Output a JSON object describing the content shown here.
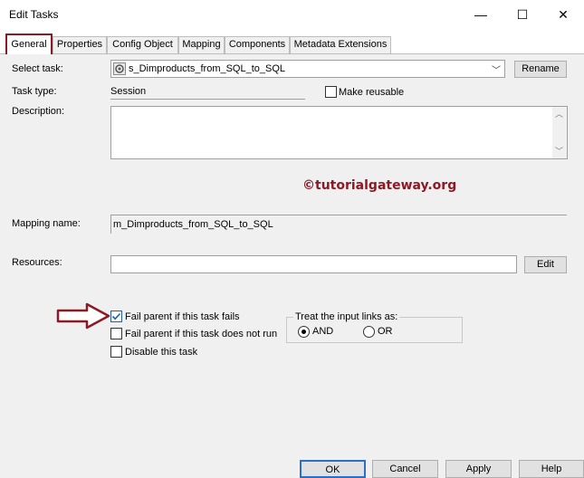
{
  "window": {
    "title": "Edit Tasks",
    "minimize_glyph": "—",
    "maximize_glyph": "☐",
    "close_glyph": "✕"
  },
  "tabs": [
    {
      "label": "General",
      "active": true
    },
    {
      "label": "Properties",
      "active": false
    },
    {
      "label": "Config Object",
      "active": false
    },
    {
      "label": "Mapping",
      "active": false
    },
    {
      "label": "Components",
      "active": false
    },
    {
      "label": "Metadata Extensions",
      "active": false
    }
  ],
  "form": {
    "select_task_label": "Select task:",
    "select_task_value": "s_Dimproducts_from_SQL_to_SQL",
    "rename_label": "Rename",
    "task_type_label": "Task type:",
    "task_type_value": "Session",
    "make_reusable_label": "Make reusable",
    "description_label": "Description:",
    "mapping_name_label": "Mapping name:",
    "mapping_name_value": "m_Dimproducts_from_SQL_to_SQL",
    "resources_label": "Resources:",
    "edit_label": "Edit"
  },
  "watermark": "©tutorialgateway.org",
  "options": {
    "fail_parent_fails_label": "Fail parent if this task fails",
    "fail_parent_fails_checked": true,
    "fail_parent_not_run_label": "Fail parent if this task does not run",
    "fail_parent_not_run_checked": false,
    "disable_task_label": "Disable this task",
    "disable_task_checked": false
  },
  "input_links": {
    "legend": "Treat the input links as:",
    "and_label": "AND",
    "or_label": "OR",
    "selected": "AND"
  },
  "footer": {
    "ok_label": "OK",
    "cancel_label": "Cancel",
    "apply_label": "Apply",
    "help_label": "Help"
  },
  "colors": {
    "accent": "#8b1a24",
    "check_blue": "#1a5fb4",
    "panel_bg": "#f0f0f0"
  }
}
